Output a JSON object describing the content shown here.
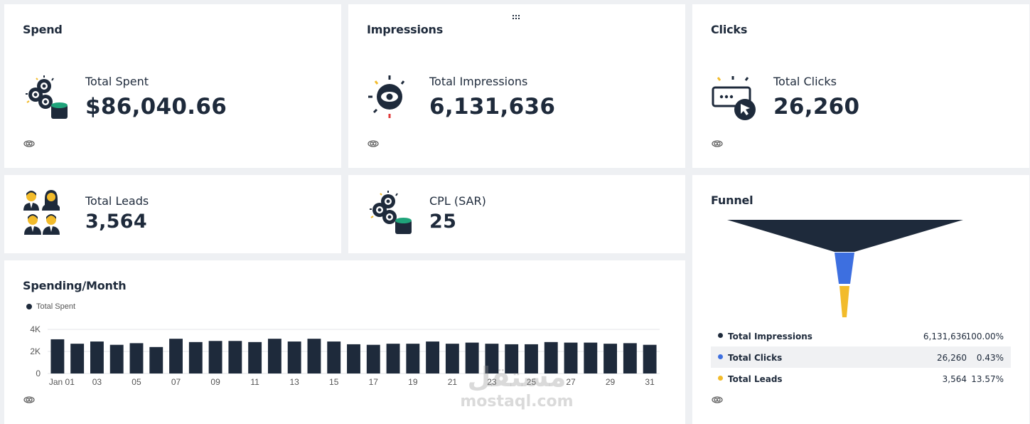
{
  "spend_card": {
    "title": "Spend",
    "label": "Total Spent",
    "value": "$86,040.66",
    "icon": "coins-eyes-icon"
  },
  "impressions_card": {
    "title": "Impressions",
    "label": "Total Impressions",
    "value": "6,131,636",
    "icon": "eye-icon"
  },
  "clicks_card": {
    "title": "Clicks",
    "label": "Total Clicks",
    "value": "26,260",
    "icon": "cursor-click-icon"
  },
  "leads_card": {
    "label": "Total Leads",
    "value": "3,564",
    "icon": "people-icon"
  },
  "cpl_card": {
    "label": "CPL (SAR)",
    "value": "25",
    "icon": "coins-eyes-icon"
  },
  "spending_chart": {
    "title": "Spending/Month",
    "legend": "Total Spent",
    "chart_data": {
      "type": "bar",
      "title": "Spending/Month",
      "series": [
        {
          "name": "Total Spent"
        }
      ],
      "categories": [
        "Jan 01",
        "02",
        "03",
        "04",
        "05",
        "06",
        "07",
        "08",
        "09",
        "10",
        "11",
        "12",
        "13",
        "14",
        "15",
        "16",
        "17",
        "18",
        "19",
        "20",
        "21",
        "22",
        "23",
        "24",
        "25",
        "26",
        "27",
        "28",
        "29",
        "30",
        "31"
      ],
      "tick_labels": [
        "Jan 01",
        "03",
        "05",
        "07",
        "09",
        "11",
        "13",
        "15",
        "17",
        "19",
        "21",
        "23",
        "25",
        "27",
        "29",
        "31"
      ],
      "y_ticks": [
        "0",
        "2K",
        "4K"
      ],
      "values": [
        3100,
        2700,
        2900,
        2600,
        2750,
        2400,
        3150,
        2850,
        2950,
        2950,
        2850,
        3150,
        2900,
        3150,
        2900,
        2650,
        2600,
        2700,
        2700,
        2900,
        2700,
        2800,
        2700,
        2650,
        2650,
        2850,
        2800,
        2800,
        2700,
        2750,
        2600
      ],
      "ylim": [
        0,
        4000
      ],
      "grid": true,
      "color": "#1e2a3b"
    }
  },
  "funnel": {
    "title": "Funnel",
    "rows": [
      {
        "name": "Total Impressions",
        "value": "6,131,636",
        "pct": "100.00%",
        "color": "#1e2a3b"
      },
      {
        "name": "Total Clicks",
        "value": "26,260",
        "pct": "0.43%",
        "color": "#3d6fe0"
      },
      {
        "name": "Total Leads",
        "value": "3,564",
        "pct": "13.57%",
        "color": "#f2bb2b"
      }
    ]
  },
  "watermark": {
    "arabic": "مستقل",
    "latin": "mostaql.com"
  }
}
